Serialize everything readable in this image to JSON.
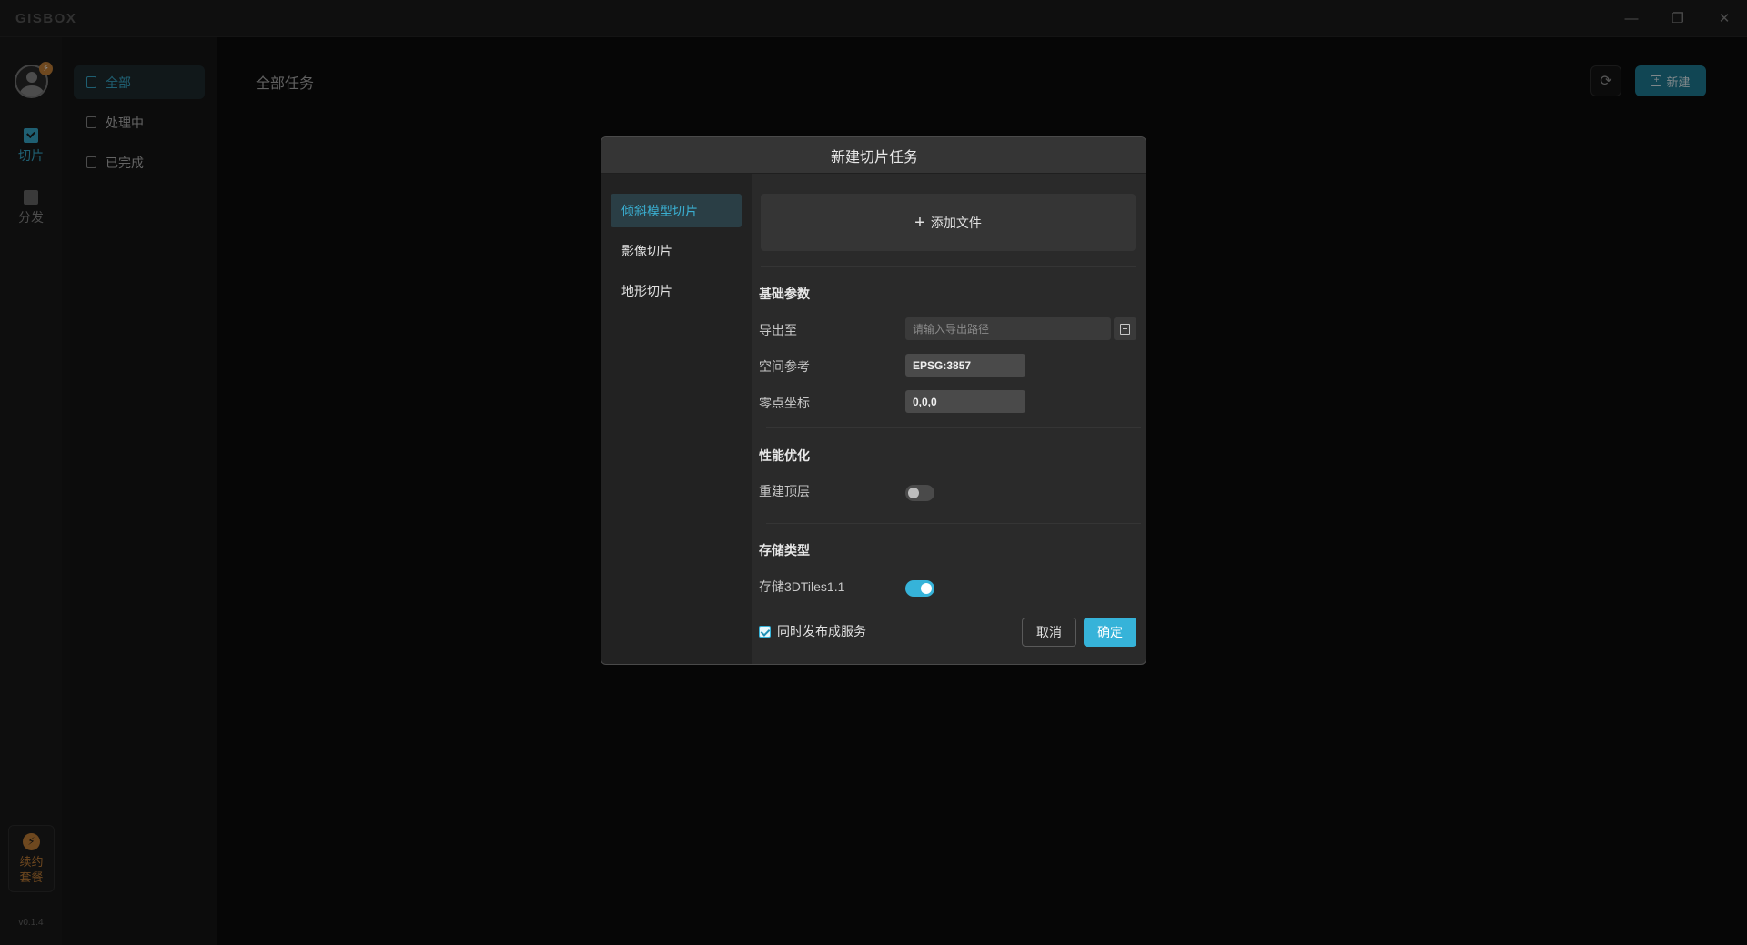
{
  "app": {
    "logo": "GISBOX"
  },
  "window_controls": {
    "minimize": "—",
    "maximize": "❐",
    "close": "✕"
  },
  "rail": {
    "avatar_badge": "⚡",
    "items": [
      {
        "label": "切片",
        "icon": "slice-icon",
        "active": true
      },
      {
        "label": "分发",
        "icon": "distribute-icon",
        "active": false
      }
    ],
    "renew": {
      "icon": "⚡",
      "label": "续约套餐"
    },
    "version": "v0.1.4"
  },
  "subnav": {
    "items": [
      {
        "label": "全部",
        "active": true
      },
      {
        "label": "处理中",
        "active": false
      },
      {
        "label": "已完成",
        "active": false
      }
    ]
  },
  "main": {
    "title": "全部任务",
    "refresh_icon": "⟳",
    "new_button": {
      "icon": "+",
      "label": "新建"
    }
  },
  "dialog": {
    "title": "新建切片任务",
    "sidebar": [
      {
        "label": "倾斜模型切片",
        "active": true
      },
      {
        "label": "影像切片",
        "active": false
      },
      {
        "label": "地形切片",
        "active": false
      }
    ],
    "add_file": {
      "icon": "+",
      "label": "添加文件"
    },
    "basic_params": {
      "title": "基础参数",
      "export": {
        "label": "导出至",
        "placeholder": "请输入导出路径",
        "value": ""
      },
      "srs": {
        "label": "空间参考",
        "value": "EPSG:3857"
      },
      "zero": {
        "label": "零点坐标",
        "value": "0,0,0"
      }
    },
    "performance": {
      "title": "性能优化",
      "rebuild": {
        "label": "重建顶层",
        "on": false
      }
    },
    "storage": {
      "title": "存储类型",
      "tiles": {
        "label": "存储3DTiles1.1",
        "on": true
      }
    },
    "publish": {
      "label": "同时发布成服务",
      "checked": true
    },
    "cancel_label": "取消",
    "ok_label": "确定"
  },
  "colors": {
    "accent": "#36b3d9",
    "accent_dark": "#1f8099",
    "warn": "#c9833a",
    "background": "#0b0b0b"
  }
}
